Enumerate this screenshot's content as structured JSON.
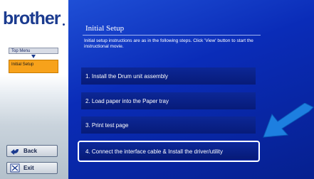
{
  "brand": {
    "logo_text": "brother"
  },
  "sidebar": {
    "top_menu_label": "Top Menu",
    "active_item_label": "Initial Setup",
    "back_label": "Back",
    "exit_label": "Exit"
  },
  "main": {
    "title": "Initial Setup",
    "intro": "Initial setup instructions are as in the following steps. Click 'View' button to start the instructional movie.",
    "steps": [
      "1. Install the Drum unit assembly",
      "2. Load paper into the Paper tray",
      "3. Print test page",
      "4. Connect the interface cable & Install the driver/utility"
    ],
    "highlighted_step_index": 3
  },
  "colors": {
    "panel_blue": "#0a2cb8",
    "active_orange": "#f7a21b",
    "pointer_arrow": "#1d7fe0"
  },
  "icons": {
    "back": "back-arrow-icon",
    "exit": "exit-icon",
    "pointer": "pointer-arrow-icon"
  }
}
